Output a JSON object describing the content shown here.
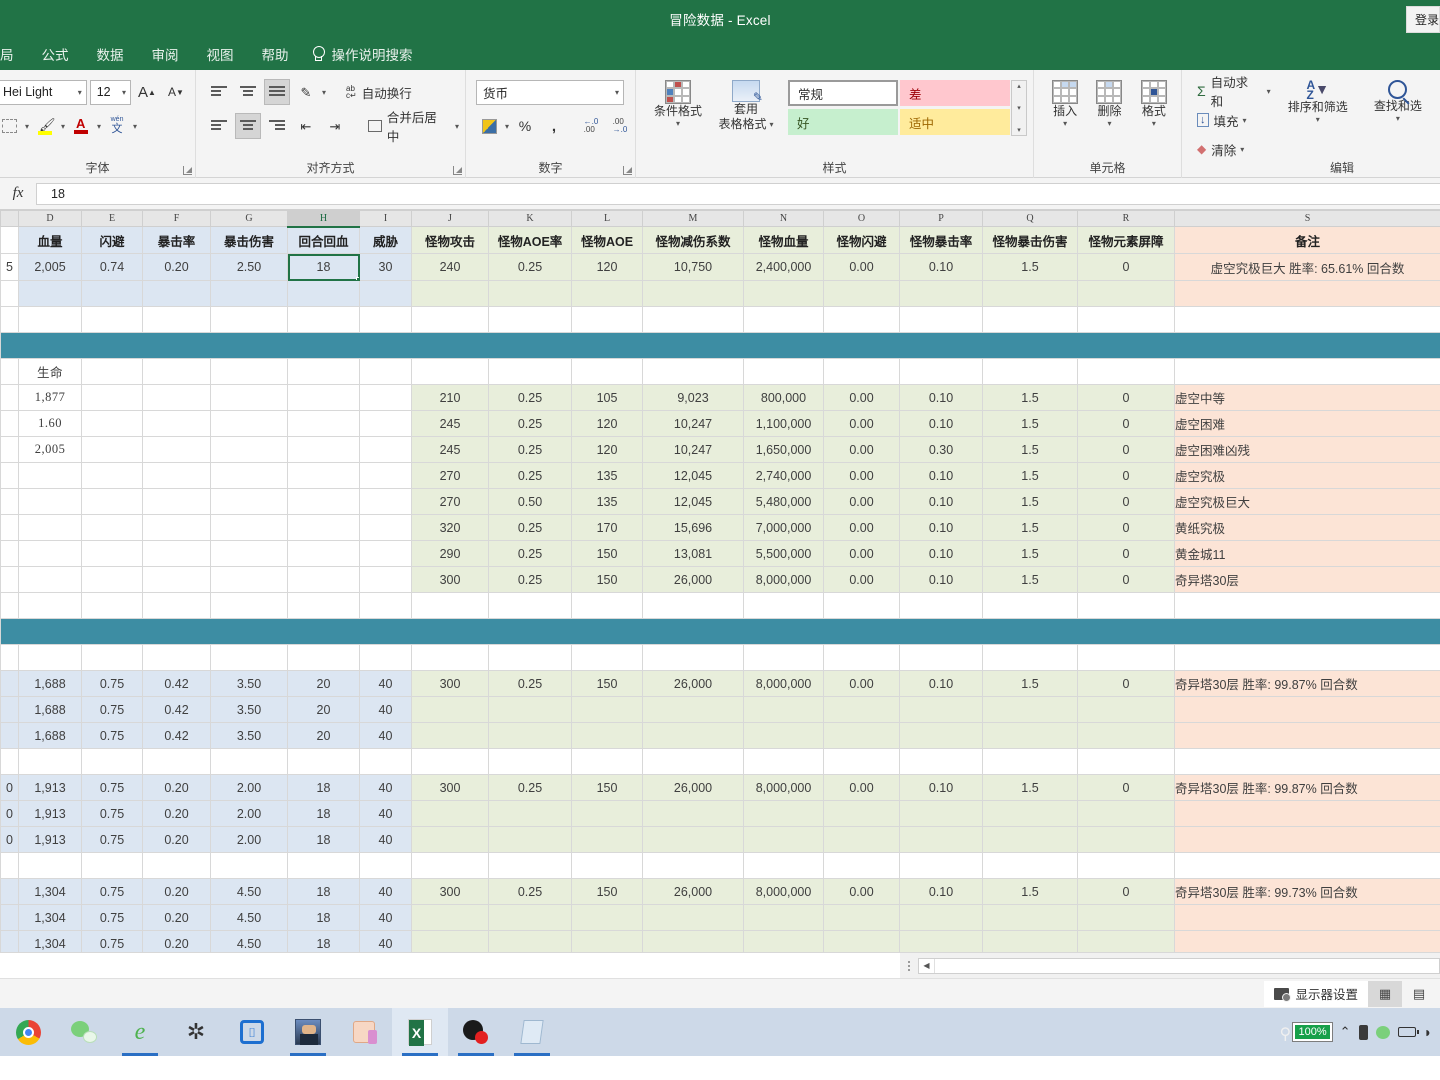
{
  "window": {
    "title": "冒险数据  -  Excel",
    "signin_label": "登录"
  },
  "ribbon": {
    "tabs": [
      {
        "label": "局",
        "clipped": true
      },
      {
        "label": "公式"
      },
      {
        "label": "数据"
      },
      {
        "label": "审阅"
      },
      {
        "label": "视图"
      },
      {
        "label": "帮助"
      }
    ],
    "tell_me": "操作说明搜索",
    "groups": {
      "font": {
        "label": "字体",
        "font_name": "Hei Light",
        "font_size": "12",
        "grow_font": "A",
        "shrink_font": "A",
        "borders_icon": "borders-icon",
        "fill_color_icon": "fill-color-icon",
        "font_color_icon": "font-color-icon",
        "phonetic_icon": "phonetic-guide-icon"
      },
      "alignment": {
        "label": "对齐方式",
        "wrap_text": "自动换行",
        "merge_center": "合并后居中",
        "orientation_icon": "text-orientation-icon",
        "indent_decrease_icon": "decrease-indent-icon",
        "indent_increase_icon": "increase-indent-icon"
      },
      "number": {
        "label": "数字",
        "format": "货币",
        "percent": "%",
        "comma": ",",
        "accounting_icon": "accounting-format-icon",
        "inc_dec": ".00",
        "dec_dec": ".00"
      },
      "styles": {
        "label": "样式",
        "conditional_formatting": "条件格式",
        "format_as_table_l1": "套用",
        "format_as_table_l2": "表格格式",
        "cell_styles": [
          "常规",
          "差",
          "好",
          "适中"
        ]
      },
      "cells": {
        "label": "单元格",
        "insert": "插入",
        "delete": "删除",
        "format": "格式"
      },
      "editing": {
        "label": "编辑",
        "autosum": "自动求和",
        "fill": "填充",
        "clear": "清除",
        "sort_filter": "排序和筛选",
        "find_select": "查找和选"
      }
    }
  },
  "formula_bar": {
    "fx_label": "fx",
    "value": "18"
  },
  "sheet": {
    "column_letters": [
      "",
      "D",
      "E",
      "F",
      "G",
      "H",
      "I",
      "J",
      "K",
      "L",
      "M",
      "N",
      "O",
      "P",
      "Q",
      "R",
      "S"
    ],
    "selected_column": "H",
    "headers": [
      "",
      "血量",
      "闪避",
      "暴击率",
      "暴击伤害",
      "回合回血",
      "威胁",
      "怪物攻击",
      "怪物AOE率",
      "怪物AOE",
      "怪物减伤系数",
      "怪物血量",
      "怪物闪避",
      "怪物暴击率",
      "怪物暴击伤害",
      "怪物元素屏障",
      "备注"
    ],
    "top_row": [
      "5",
      "2,005",
      "0.74",
      "0.20",
      "2.50",
      "18",
      "30",
      "240",
      "0.25",
      "120",
      "10,750",
      "2,400,000",
      "0.00",
      "0.10",
      "1.5",
      "0",
      "虚空究极巨大 胜率: 65.61% 回合数"
    ],
    "life_label": "生命",
    "life_values": [
      "1,877",
      "1.60",
      "2,005"
    ],
    "monster_block": [
      {
        "atk": "210",
        "aoe_rate": "0.25",
        "aoe": "105",
        "reduce": "9,023",
        "hp": "800,000",
        "dodge": "0.00",
        "crit": "0.10",
        "critdmg": "1.5",
        "shield": "0",
        "remark": "虚空中等"
      },
      {
        "atk": "245",
        "aoe_rate": "0.25",
        "aoe": "120",
        "reduce": "10,247",
        "hp": "1,100,000",
        "dodge": "0.00",
        "crit": "0.10",
        "critdmg": "1.5",
        "shield": "0",
        "remark": "虚空困难"
      },
      {
        "atk": "245",
        "aoe_rate": "0.25",
        "aoe": "120",
        "reduce": "10,247",
        "hp": "1,650,000",
        "dodge": "0.00",
        "crit": "0.30",
        "critdmg": "1.5",
        "shield": "0",
        "remark": "虚空困难凶残"
      },
      {
        "atk": "270",
        "aoe_rate": "0.25",
        "aoe": "135",
        "reduce": "12,045",
        "hp": "2,740,000",
        "dodge": "0.00",
        "crit": "0.10",
        "critdmg": "1.5",
        "shield": "0",
        "remark": "虚空究极"
      },
      {
        "atk": "270",
        "aoe_rate": "0.50",
        "aoe": "135",
        "reduce": "12,045",
        "hp": "5,480,000",
        "dodge": "0.00",
        "crit": "0.10",
        "critdmg": "1.5",
        "shield": "0",
        "remark": "虚空究极巨大"
      },
      {
        "atk": "320",
        "aoe_rate": "0.25",
        "aoe": "170",
        "reduce": "15,696",
        "hp": "7,000,000",
        "dodge": "0.00",
        "crit": "0.10",
        "critdmg": "1.5",
        "shield": "0",
        "remark": "黄纸究极"
      },
      {
        "atk": "290",
        "aoe_rate": "0.25",
        "aoe": "150",
        "reduce": "13,081",
        "hp": "5,500,000",
        "dodge": "0.00",
        "crit": "0.10",
        "critdmg": "1.5",
        "shield": "0",
        "remark": "黄金城11"
      },
      {
        "atk": "300",
        "aoe_rate": "0.25",
        "aoe": "150",
        "reduce": "26,000",
        "hp": "8,000,000",
        "dodge": "0.00",
        "crit": "0.10",
        "critdmg": "1.5",
        "shield": "0",
        "remark": "奇异塔30层"
      }
    ],
    "player_blocks": [
      {
        "rows": [
          {
            "c": "",
            "hp": "1,688",
            "dodge": "0.75",
            "crit": "0.42",
            "critdmg": "3.50",
            "regen": "20",
            "threat": "40"
          },
          {
            "c": "",
            "hp": "1,688",
            "dodge": "0.75",
            "crit": "0.42",
            "critdmg": "3.50",
            "regen": "20",
            "threat": "40"
          },
          {
            "c": "",
            "hp": "1,688",
            "dodge": "0.75",
            "crit": "0.42",
            "critdmg": "3.50",
            "regen": "20",
            "threat": "40"
          }
        ],
        "monster": {
          "atk": "300",
          "aoe_rate": "0.25",
          "aoe": "150",
          "reduce": "26,000",
          "hp": "8,000,000",
          "dodge": "0.00",
          "crit": "0.10",
          "critdmg": "1.5",
          "shield": "0"
        },
        "remark": "奇异塔30层 胜率: 99.87% 回合数"
      },
      {
        "rows": [
          {
            "c": "0",
            "hp": "1,913",
            "dodge": "0.75",
            "crit": "0.20",
            "critdmg": "2.00",
            "regen": "18",
            "threat": "40"
          },
          {
            "c": "0",
            "hp": "1,913",
            "dodge": "0.75",
            "crit": "0.20",
            "critdmg": "2.00",
            "regen": "18",
            "threat": "40"
          },
          {
            "c": "0",
            "hp": "1,913",
            "dodge": "0.75",
            "crit": "0.20",
            "critdmg": "2.00",
            "regen": "18",
            "threat": "40"
          }
        ],
        "monster": {
          "atk": "300",
          "aoe_rate": "0.25",
          "aoe": "150",
          "reduce": "26,000",
          "hp": "8,000,000",
          "dodge": "0.00",
          "crit": "0.10",
          "critdmg": "1.5",
          "shield": "0"
        },
        "remark": "奇异塔30层 胜率: 99.87% 回合数"
      },
      {
        "rows": [
          {
            "c": "",
            "hp": "1,304",
            "dodge": "0.75",
            "crit": "0.20",
            "critdmg": "4.50",
            "regen": "18",
            "threat": "40"
          },
          {
            "c": "",
            "hp": "1,304",
            "dodge": "0.75",
            "crit": "0.20",
            "critdmg": "4.50",
            "regen": "18",
            "threat": "40"
          },
          {
            "c": "",
            "hp": "1,304",
            "dodge": "0.75",
            "crit": "0.20",
            "critdmg": "4.50",
            "regen": "18",
            "threat": "40"
          }
        ],
        "monster": {
          "atk": "300",
          "aoe_rate": "0.25",
          "aoe": "150",
          "reduce": "26,000",
          "hp": "8,000,000",
          "dodge": "0.00",
          "crit": "0.10",
          "critdmg": "1.5",
          "shield": "0"
        },
        "remark": "奇异塔30层 胜率: 99.73% 回合数"
      }
    ]
  },
  "status_bar": {
    "display_settings": "显示器设置",
    "view_normal_icon": "normal-view-icon",
    "view_layout_icon": "page-layout-view-icon"
  },
  "taskbar": {
    "items": [
      {
        "name": "chrome-icon"
      },
      {
        "name": "wechat-icon"
      },
      {
        "name": "internet-explorer-icon"
      },
      {
        "name": "settings-gear-icon"
      },
      {
        "name": "app-blue-icon"
      },
      {
        "name": "game-avatar-icon"
      },
      {
        "name": "app-pink-icon"
      },
      {
        "name": "excel-icon"
      },
      {
        "name": "media-player-icon"
      },
      {
        "name": "notepad-icon"
      }
    ],
    "battery_percent": "100%",
    "tray": [
      "chevron-up-icon",
      "phone-icon",
      "wechat-tray-icon",
      "battery-icon",
      "wifi-icon"
    ]
  },
  "colors": {
    "excel_green": "#217346",
    "teal_divider": "#3d8da3",
    "blue_fill": "#dce6f2",
    "green_fill": "#e8eedb",
    "peach_fill": "#fce4d6"
  }
}
